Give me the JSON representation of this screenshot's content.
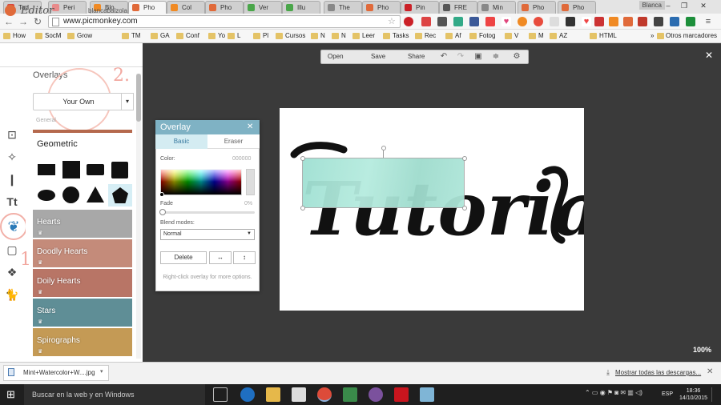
{
  "browser": {
    "tabs": [
      {
        "label": "Tod",
        "color": "#d9453b"
      },
      {
        "label": "Peri",
        "color": "#e88a8a"
      },
      {
        "label": "Blo",
        "color": "#f08a24"
      },
      {
        "label": "Pho",
        "color": "#e06a3a"
      },
      {
        "label": "Col",
        "color": "#f08a24"
      },
      {
        "label": "Pho",
        "color": "#e06a3a"
      },
      {
        "label": "Ver",
        "color": "#4aa64a"
      },
      {
        "label": "Illu",
        "color": "#4aa64a"
      },
      {
        "label": "The",
        "color": "#888888"
      },
      {
        "label": "Pho",
        "color": "#e06a3a"
      },
      {
        "label": "Pin",
        "color": "#cb2027"
      },
      {
        "label": "FRE",
        "color": "#555555"
      },
      {
        "label": "Min",
        "color": "#888888"
      },
      {
        "label": "Pho",
        "color": "#e06a3a"
      },
      {
        "label": "Pho",
        "color": "#e06a3a"
      }
    ],
    "user": "Blanca",
    "url": "www.picmonkey.com",
    "bookmarks": [
      "How",
      "SocM",
      "Grow",
      "TM",
      "GA",
      "Conf",
      "Yo",
      "L",
      "Pl",
      "Cursos",
      "N",
      "N",
      "Leer",
      "Tasks",
      "Rec",
      "Af",
      "Fotog",
      "V",
      "M",
      "AZ",
      "HTML"
    ],
    "other_bookmarks": "Otros marcadores"
  },
  "editor": {
    "title": "Editor",
    "username": "blancabalzola",
    "toolbar": {
      "open": "Open",
      "save": "Save",
      "share": "Share"
    },
    "zoom": "100%"
  },
  "panel": {
    "title": "Overlays",
    "your_own": "Your Own",
    "general_label": "General",
    "geometric_label": "Geometric",
    "categories": [
      {
        "label": "Hearts",
        "color": "#a8a8a8"
      },
      {
        "label": "Doodly Hearts",
        "color": "#c48b7a"
      },
      {
        "label": "Doily Hearts",
        "color": "#b87566"
      },
      {
        "label": "Stars",
        "color": "#5f8e96"
      },
      {
        "label": "Spirographs",
        "color": "#c49a55"
      }
    ],
    "annotations": {
      "step1": "1.",
      "step2": "2."
    }
  },
  "overlay_dialog": {
    "title": "Overlay",
    "tab_basic": "Basic",
    "tab_eraser": "Eraser",
    "color_label": "Color:",
    "color_value": "000000",
    "fade_label": "Fade",
    "fade_value": "0%",
    "blend_label": "Blend modes:",
    "blend_value": "Normal",
    "delete_label": "Delete",
    "hint": "Right-click overlay for more options."
  },
  "canvas": {
    "script_text": "Tutorial"
  },
  "downloads": {
    "file": "Mint+Watercolor+W....jpg",
    "show_all": "Mostrar todas las descargas..."
  },
  "taskbar": {
    "search_placeholder": "Buscar en la web y en Windows",
    "lang": "ESP",
    "time": "18:36",
    "date": "14/10/2015"
  }
}
